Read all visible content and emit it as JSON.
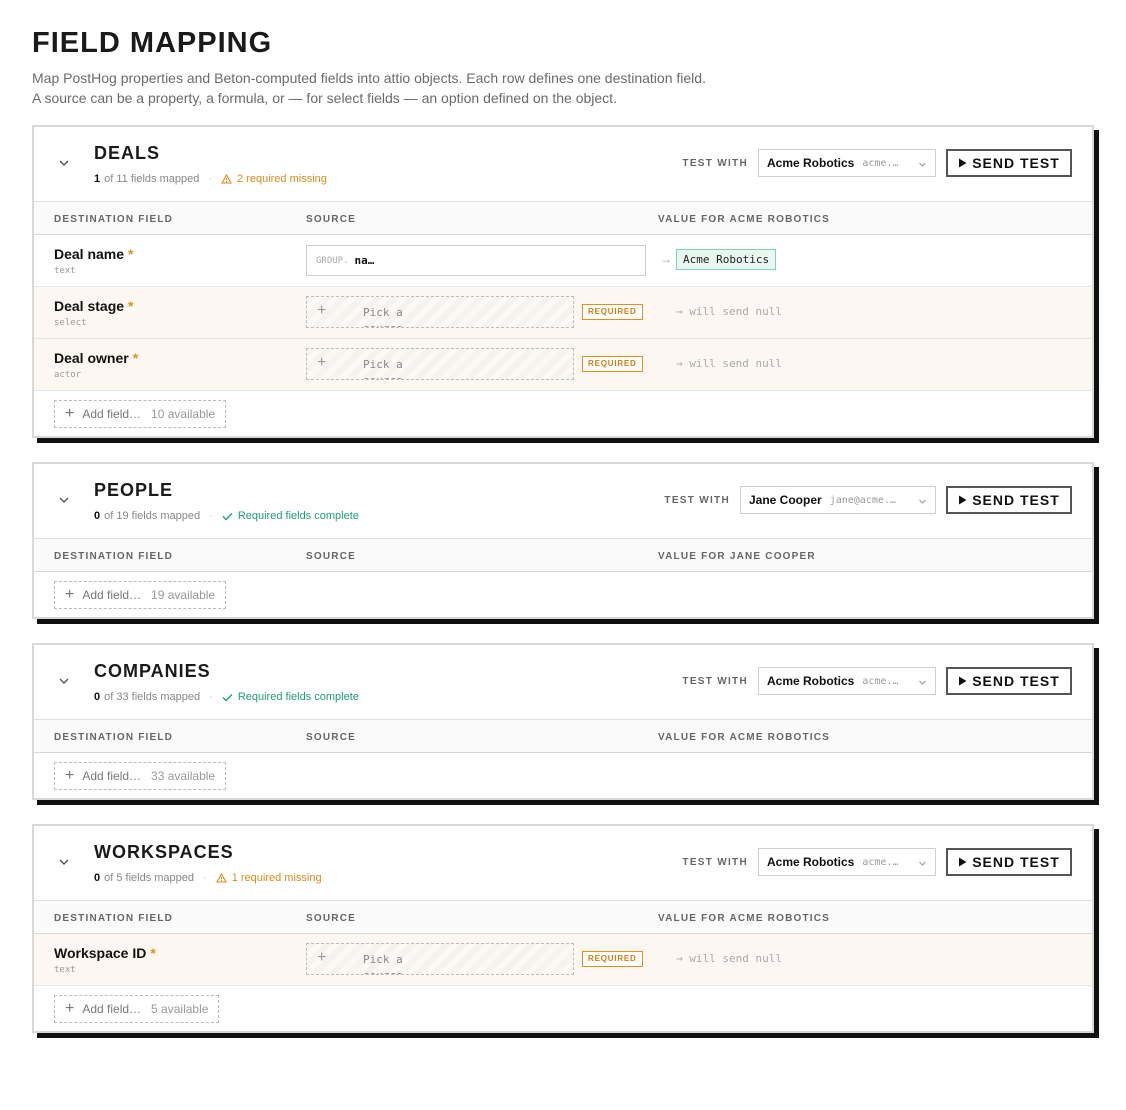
{
  "page": {
    "title": "FIELD MAPPING",
    "description": "Map PostHog properties and Beton-computed fields into attio objects. Each row defines one destination field. A source can be a property, a formula, or — for select fields — an option defined on the object."
  },
  "common": {
    "test_with": "TEST WITH",
    "send_test": "SEND TEST",
    "col_destination": "DESTINATION FIELD",
    "col_source": "SOURCE",
    "required_badge": "REQUIRED",
    "pick_source": "Pick a source…",
    "will_send_null": "→ will send null",
    "add_field": "Add field…",
    "required_star": "*",
    "plus": "+",
    "arrow": "→",
    "sep": "·",
    "fields_mapped_suffix": "fields mapped"
  },
  "objects": [
    {
      "title": "DEALS",
      "mapped_count": "1",
      "of_total": "of 11 fields mapped",
      "status_text": "2 required missing",
      "status_kind": "warn",
      "test_name": "Acme Robotics",
      "test_email": "acme.…",
      "col_value": "VALUE FOR ACME ROBOTICS",
      "add_available": "10 available",
      "rows": [
        {
          "name": "Deal name",
          "type": "text",
          "source_prefix": "GROUP.",
          "source_value": "na…",
          "value": "Acme Robotics"
        },
        {
          "name": "Deal stage",
          "type": "select"
        },
        {
          "name": "Deal owner",
          "type": "actor"
        }
      ]
    },
    {
      "title": "PEOPLE",
      "mapped_count": "0",
      "of_total": "of 19 fields mapped",
      "status_text": "Required fields complete",
      "status_kind": "ok",
      "test_name": "Jane Cooper",
      "test_email": "jane@acme.…",
      "col_value": "VALUE FOR JANE COOPER",
      "add_available": "19 available"
    },
    {
      "title": "COMPANIES",
      "mapped_count": "0",
      "of_total": "of 33 fields mapped",
      "status_text": "Required fields complete",
      "status_kind": "ok",
      "test_name": "Acme Robotics",
      "test_email": "acme.…",
      "col_value": "VALUE FOR ACME ROBOTICS",
      "add_available": "33 available"
    },
    {
      "title": "WORKSPACES",
      "mapped_count": "0",
      "of_total": "of 5 fields mapped",
      "status_text": "1 required missing",
      "status_kind": "warn",
      "test_name": "Acme Robotics",
      "test_email": "acme.…",
      "col_value": "VALUE FOR ACME ROBOTICS",
      "add_available": "5 available",
      "rows": [
        {
          "name": "Workspace ID",
          "type": "text"
        }
      ]
    }
  ],
  "colors": {
    "warn": "#d98b1b",
    "ok": "#1f9e74",
    "required_row_bg": "#fcf8f1",
    "value_chip_bg": "#e8f7f0"
  },
  "icons": {
    "chevron": "chevron-down-icon",
    "warn": "warning-triangle-icon",
    "ok": "check-icon",
    "play": "play-icon",
    "caret": "select-caret-icon"
  }
}
